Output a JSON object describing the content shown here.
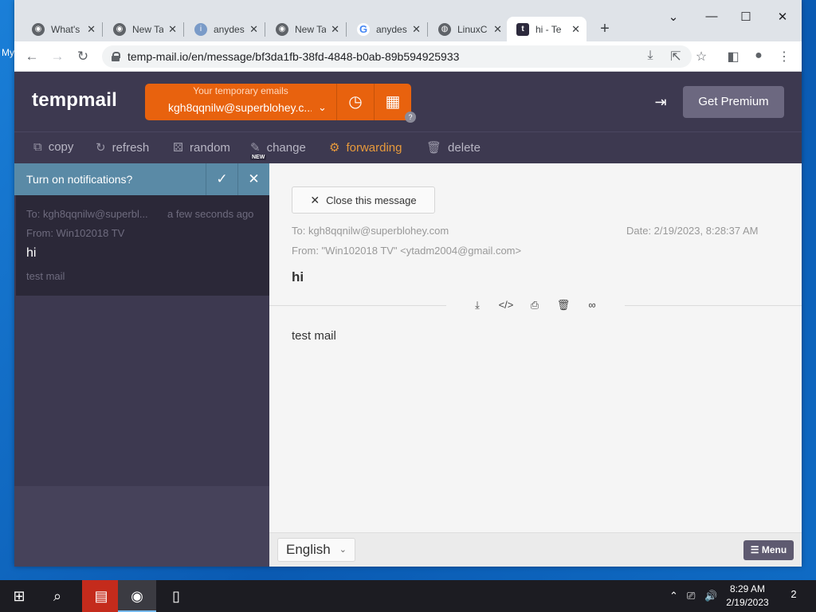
{
  "desktop": {
    "label": "My"
  },
  "browser": {
    "tabs": [
      {
        "label": "What's",
        "favicon": "chrome-icon"
      },
      {
        "label": "New Ta",
        "favicon": "chrome-icon"
      },
      {
        "label": "anydes",
        "favicon": "info-icon"
      },
      {
        "label": "New Ta",
        "favicon": "chrome-icon"
      },
      {
        "label": "anydes",
        "favicon": "google-icon"
      },
      {
        "label": "LinuxC",
        "favicon": "globe-icon"
      },
      {
        "label": "hi - Te",
        "favicon": "tempmail-icon",
        "active": true
      }
    ],
    "tab_close_glyph": "✕",
    "new_tab_glyph": "+",
    "url": "temp-mail.io/en/message/bf3da1fb-38fd-4848-b0ab-89b594925933"
  },
  "tempmail": {
    "logo": "tempmail",
    "email_caption": "Your temporary emails",
    "email_address": "kgh8qqnilw@superblohey.c...",
    "help_badge": "?",
    "premium_label": "Get Premium",
    "actions": [
      {
        "label": "copy",
        "icon": "copy-icon"
      },
      {
        "label": "refresh",
        "icon": "refresh-icon"
      },
      {
        "label": "random",
        "icon": "random-icon"
      },
      {
        "label": "change",
        "icon": "change-icon"
      },
      {
        "label": "forwarding",
        "icon": "gear-icon"
      },
      {
        "label": "delete",
        "icon": "trash-icon"
      }
    ],
    "new_badge": "NEW",
    "notification_prompt": "Turn on notifications?",
    "inbox": [
      {
        "to": "To: kgh8qqnilw@superbl...",
        "time": "a few seconds ago",
        "from": "From: Win102018 TV",
        "subject": "hi",
        "preview": "test mail"
      }
    ],
    "message": {
      "close_label": "Close this message",
      "to": "To: kgh8qqnilw@superblohey.com",
      "date": "Date: 2/19/2023, 8:28:37 AM",
      "from": "From: \"Win102018 TV\" <ytadm2004@gmail.com>",
      "subject": "hi",
      "body": "test mail",
      "tools": [
        "download-icon",
        "source-code-icon",
        "print-icon",
        "trash-icon",
        "reader-icon"
      ]
    },
    "language": "English",
    "menu_label": "Menu"
  },
  "taskbar": {
    "time": "8:29 AM",
    "date": "2/19/2023",
    "notification_count": "2"
  }
}
